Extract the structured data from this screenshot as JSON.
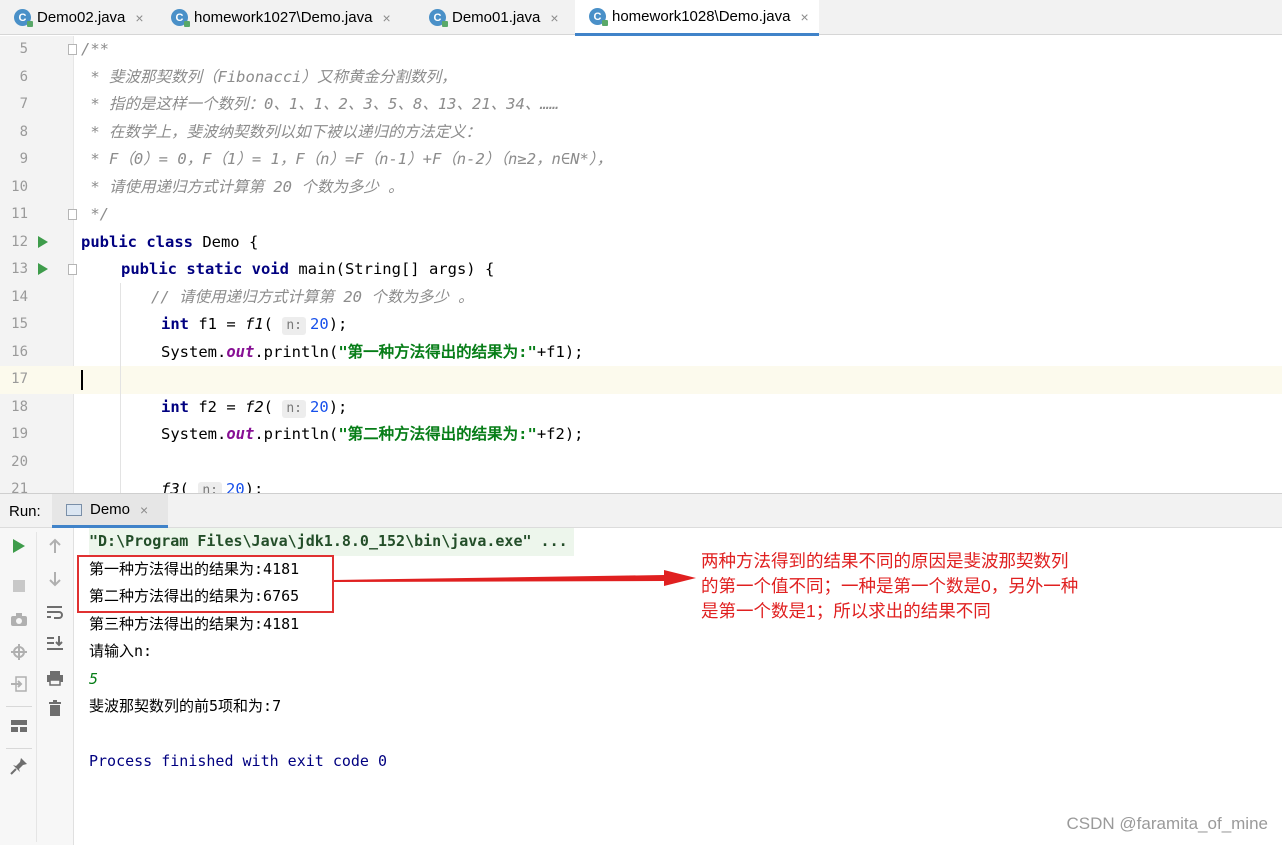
{
  "tabs": [
    {
      "label": "Demo02.java",
      "close": "×"
    },
    {
      "label": "homework1027\\Demo.java",
      "close": "×"
    },
    {
      "label": "Demo01.java",
      "close": "×"
    },
    {
      "label": "homework1028\\Demo.java",
      "close": "×"
    }
  ],
  "active_tab": 3,
  "editor": {
    "line_numbers": [
      "5",
      "6",
      "7",
      "8",
      "9",
      "10",
      "11",
      "12",
      "13",
      "14",
      "15",
      "16",
      "17",
      "18",
      "19",
      "20",
      "21"
    ],
    "comment_lines": [
      "/**",
      " * 斐波那契数列（Fibonacci）又称黄金分割数列，",
      " * 指的是这样一个数列：0、1、1、2、3、5、8、13、21、34、……",
      " * 在数学上，斐波纳契数列以如下被以递归的方法定义：",
      " * F（0）= 0，F（1）= 1，F（n）=F（n-1）+F（n-2）（n≥2，n∈N*），",
      " * 请使用递归方式计算第 20 个数为多少 。",
      " */"
    ],
    "class_kw": "public class",
    "class_name": " Demo {",
    "main_kw": "public static void",
    "main_sig": " main(String[] args) {",
    "inline_comment": "// 请使用递归方式计算第 20 个数为多少 。",
    "int_kw": "int",
    "f1_lhs": " f1 = ",
    "f1_call": "f1",
    "f2_lhs": " f2 = ",
    "f2_call": "f2",
    "f3_call": "f3",
    "paren_open": "(",
    "hint_label": "n:",
    "arg_value": "20",
    "paren_close": ");",
    "sysout_prefix": "System.",
    "sysout_field": "out",
    "println_open": ".println(",
    "str1": "\"第一种方法得出的结果为:\"",
    "concat1": "+f1);",
    "str2": "\"第二种方法得出的结果为:\"",
    "concat2": "+f2);"
  },
  "run": {
    "label": "Run:",
    "tab_label": "Demo",
    "tab_close": "×",
    "console": {
      "command": "\"D:\\Program Files\\Java\\jdk1.8.0_152\\bin\\java.exe\" ...",
      "result1": "第一种方法得出的结果为:4181",
      "result2": "第二种方法得出的结果为:6765",
      "result3": "第三种方法得出的结果为:4181",
      "prompt": "请输入n:",
      "user_input": "5",
      "sum": "斐波那契数列的前5项和为:7",
      "finished": "Process finished with exit code 0"
    }
  },
  "annotation": {
    "line1": "两种方法得到的结果不同的原因是斐波那契数列",
    "line2": "的第一个值不同；一种是第一个数是0，另外一种",
    "line3": "是第一个数是1；所以求出的结果不同",
    "color": "#e02020"
  },
  "watermark": "CSDN @faramita_of_mine",
  "colors": {
    "accent": "#4083c9",
    "keyword": "#000080",
    "string": "#067d17",
    "number": "#1750eb",
    "comment": "#8c8c8c",
    "run_green": "#3e9c4b"
  }
}
